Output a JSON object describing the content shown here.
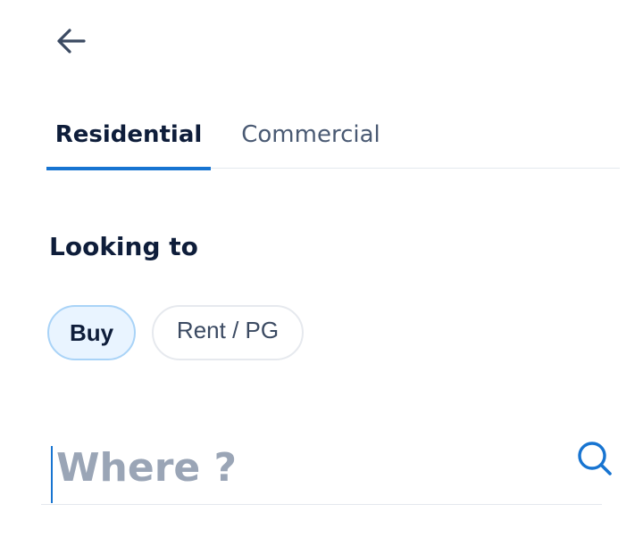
{
  "header": {
    "back_icon": "arrow-left-icon"
  },
  "tabs": [
    {
      "label": "Residential",
      "active": true
    },
    {
      "label": "Commercial",
      "active": false
    }
  ],
  "looking_to": {
    "title": "Looking to",
    "options": [
      {
        "label": "Buy",
        "selected": true
      },
      {
        "label": "Rent / PG",
        "selected": false
      }
    ]
  },
  "search": {
    "placeholder": "Where ?",
    "value": "",
    "icon": "search-icon"
  },
  "colors": {
    "accent": "#1774d1",
    "text_primary": "#0e1d3a",
    "selected_chip_bg": "#e9f4ff",
    "selected_chip_border": "#a9d3f7"
  }
}
